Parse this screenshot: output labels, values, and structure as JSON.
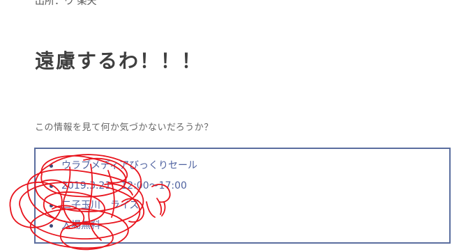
{
  "page": {
    "cut_top_text": "出所：ウ 楽天",
    "heading": "遠慮するわ！！！",
    "intro": "この情報を見て何か気づかないだろうか？"
  },
  "info": {
    "items": [
      "ウラブメディアびっくりセール",
      "2019.3.21　12:00〜17:00",
      "二子玉川　ライズ",
      "入場無料"
    ]
  },
  "colors": {
    "box_border": "#5a6d9e",
    "list_text": "#4f62a0",
    "scribble": "#e8141d"
  }
}
